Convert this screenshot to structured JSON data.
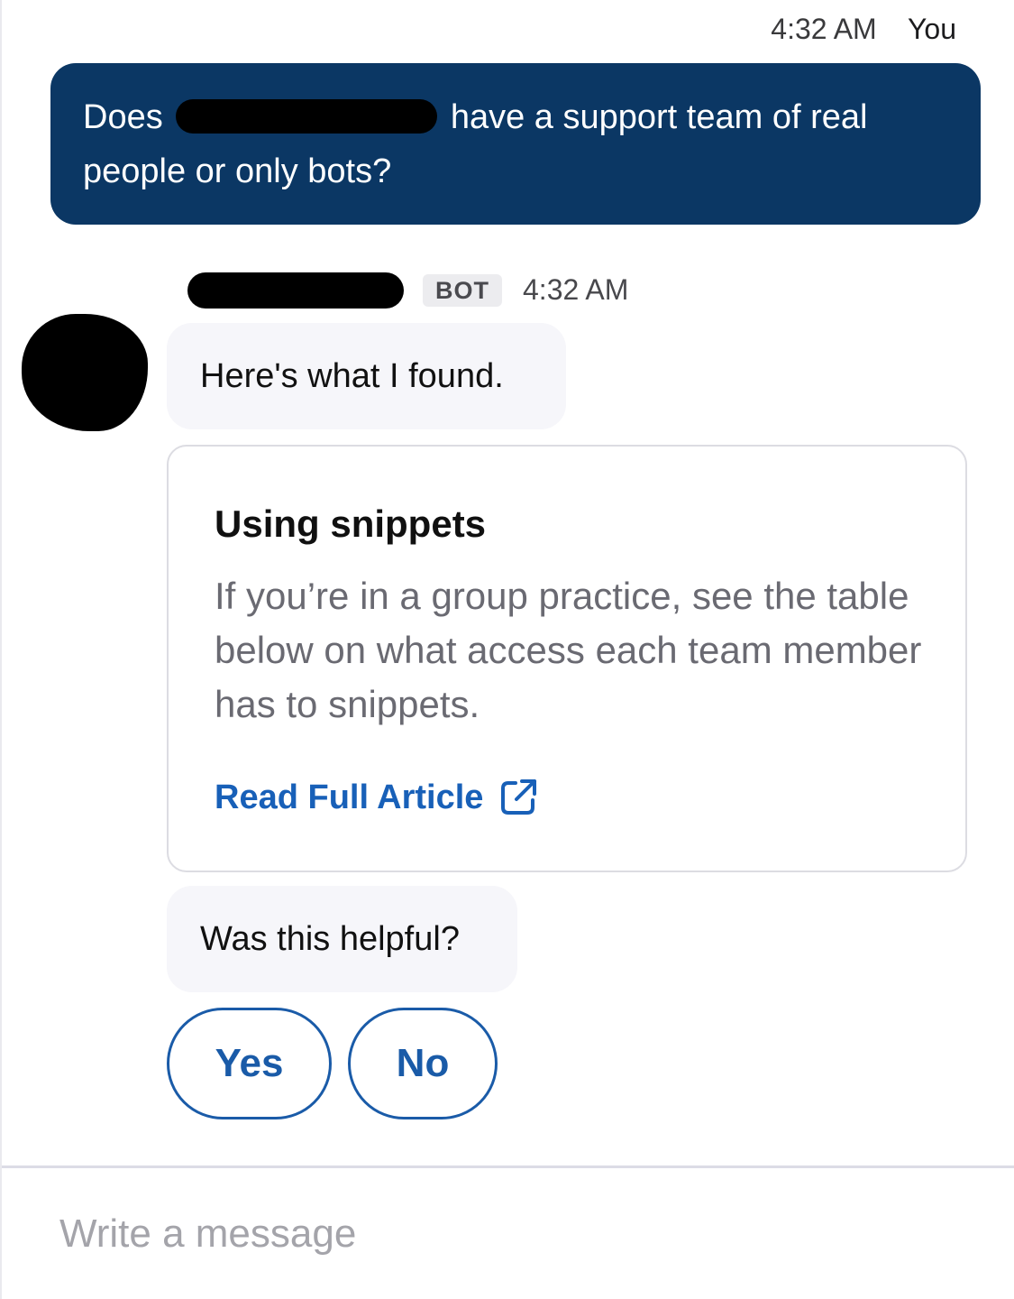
{
  "user_message": {
    "time": "4:32 AM",
    "author": "You",
    "text_before": "Does",
    "text_after": "have a support team of real people or only bots?"
  },
  "bot": {
    "badge": "BOT",
    "time": "4:32 AM"
  },
  "messages": {
    "found": "Here's what I found.",
    "helpful": "Was this helpful?"
  },
  "article": {
    "title": "Using snippets",
    "excerpt": "If you’re in a group practice, see the table below on what access each team member has to snippets.",
    "link_label": "Read Full Article",
    "link_icon": "external-link-icon"
  },
  "feedback": {
    "yes_label": "Yes",
    "no_label": "No"
  },
  "composer": {
    "placeholder": "Write a message"
  },
  "colors": {
    "user_bubble": "#0b3764",
    "bot_bubble": "#f6f6fa",
    "accent": "#1a5ba8",
    "link": "#1860b8"
  }
}
